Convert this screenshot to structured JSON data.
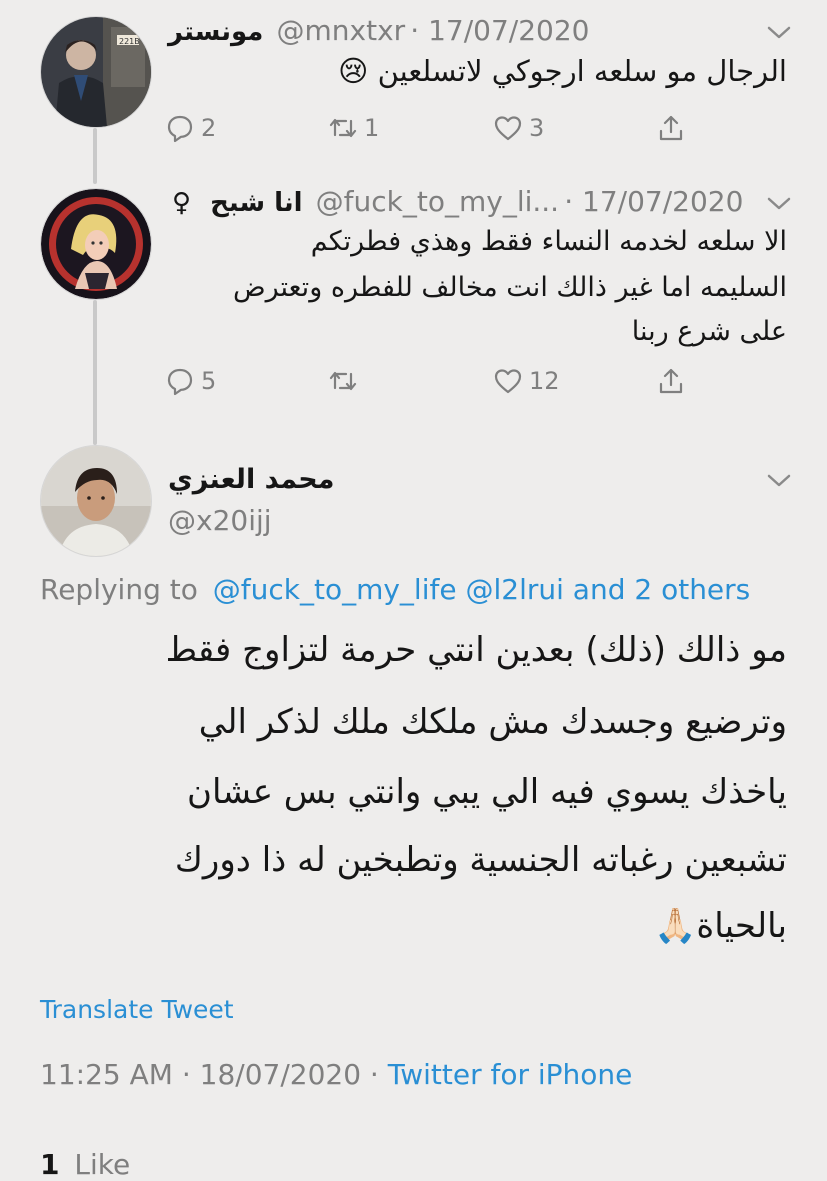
{
  "tweets": [
    {
      "display_name": "مونستر",
      "handle": "@mnxtxr",
      "date": "17/07/2020",
      "text": "الرجال مو سلعه ارجوكي لاتسلعين 😢",
      "replies": "2",
      "retweets": "1",
      "likes": "3"
    },
    {
      "display_name": "انا شبح",
      "gender_symbol": "♀",
      "handle": "@fuck_to_my_li...",
      "date": "17/07/2020",
      "text_lines": [
        "الا سلعه لخدمه النساء فقط وهذي فطرتكم",
        "السليمه اما غير ذالك انت مخالف للفطره وتعترض",
        "على شرع ربنا"
      ],
      "replies": "5",
      "retweets": "",
      "likes": "12"
    }
  ],
  "main_tweet": {
    "display_name": "محمد العنزي",
    "handle": "@x20ijj",
    "replying_prefix": "Replying to",
    "replying_to": "@fuck_to_my_life @l2lrui and 2 others",
    "text_lines": [
      "مو ذالك (ذلك) بعدين انتي حرمة لتزاوج فقط",
      "وترضيع وجسدك مش ملكك ملك لذكر الي",
      "ياخذك يسوي فيه الي يبي وانتي بس عشان",
      "تشبعين رغباته الجنسية وتطبخين له ذا دورك",
      "بالحياة🙏🏻"
    ],
    "translate": "Translate Tweet",
    "time": "11:25 AM",
    "date": "18/07/2020",
    "client": "Twitter for iPhone",
    "likes_count": "1",
    "likes_label": "Like"
  },
  "icons": [
    "reply-icon",
    "retweet-icon",
    "like-icon",
    "share-icon",
    "chevron-down-icon"
  ],
  "colors": {
    "link": "#2a8fd4",
    "muted": "#7f7f7f",
    "background": "#eeedec"
  }
}
